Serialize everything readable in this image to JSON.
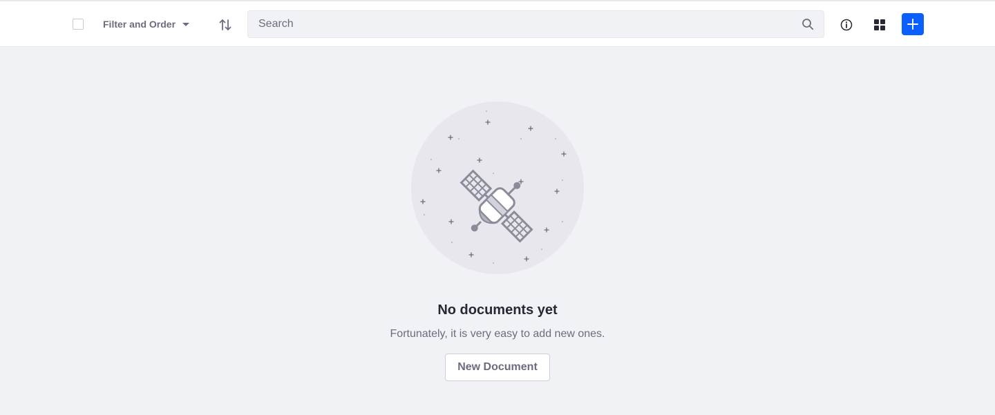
{
  "toolbar": {
    "filter_label": "Filter and Order",
    "search_placeholder": "Search",
    "icons": {
      "filter_caret": "caret-down-icon",
      "sort": "sort-arrows-icon",
      "search": "search-icon",
      "info": "info-icon",
      "display": "cards-icon",
      "add": "plus-icon"
    },
    "accent_color": "#0b5fff"
  },
  "empty_state": {
    "title": "No documents yet",
    "description": "Fortunately, it is very easy to add new ones.",
    "button_label": "New Document",
    "illustration": "satellite-illustration"
  },
  "colors": {
    "background": "#f1f2f5",
    "surface": "#ffffff",
    "text_primary": "#272833",
    "text_secondary": "#6b6c7e",
    "illustration_fill": "#e7e7ed",
    "illustration_stroke": "#8b8c99"
  }
}
